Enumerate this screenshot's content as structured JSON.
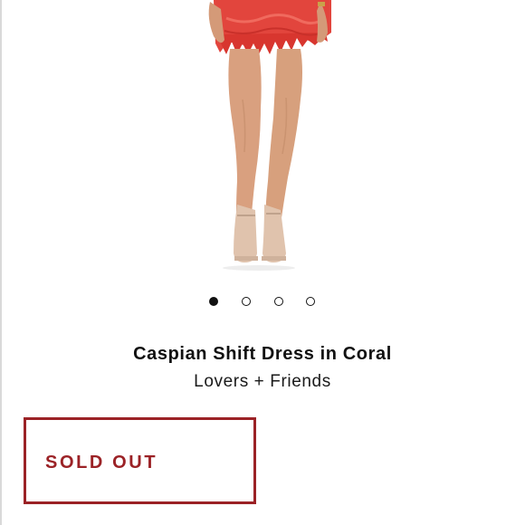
{
  "gallery": {
    "image_icon": "product-photo-coral-lace-dress",
    "dots": [
      {
        "active": true
      },
      {
        "active": false
      },
      {
        "active": false
      },
      {
        "active": false
      }
    ]
  },
  "product": {
    "title": "Caspian Shift Dress in Coral",
    "brand": "Lovers + Friends"
  },
  "status": {
    "label": "SOLD OUT",
    "color": "#9b2226"
  },
  "colors": {
    "dress": "#e2453d",
    "skin": "#d9a07f"
  }
}
